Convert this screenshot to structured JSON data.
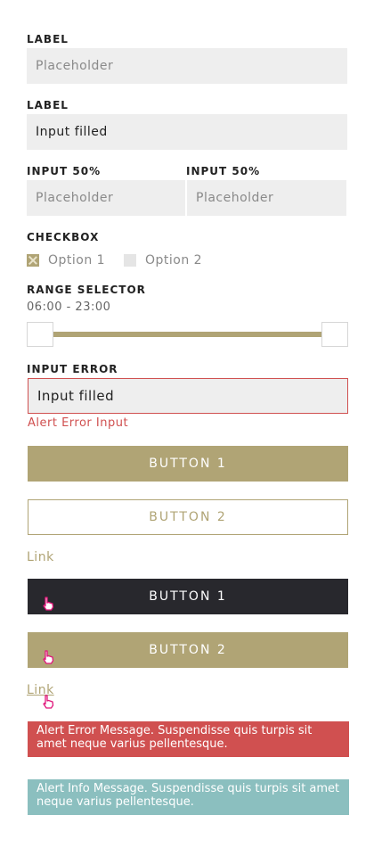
{
  "form": {
    "field1": {
      "label": "LABEL",
      "placeholder": "Placeholder"
    },
    "field2": {
      "label": "LABEL",
      "value": "Input filled"
    },
    "half_left": {
      "label": "INPUT 50%",
      "placeholder": "Placeholder"
    },
    "half_right": {
      "label": "INPUT 50%",
      "placeholder": "Placeholder"
    },
    "checkbox": {
      "label": "CHECKBOX",
      "options": [
        {
          "label": "Option 1",
          "checked": true
        },
        {
          "label": "Option 2",
          "checked": false
        }
      ]
    },
    "range": {
      "label": "RANGE SELECTOR",
      "value_text": "06:00 - 23:00"
    },
    "error_field": {
      "label": "INPUT ERROR",
      "value": "Input filled",
      "error_text": "Alert Error Input"
    }
  },
  "buttons": {
    "primary": "BUTTON 1",
    "secondary": "BUTTON 2",
    "link": "Link",
    "hover_primary": "BUTTON 1",
    "hover_secondary": "BUTTON 2",
    "hover_link": "Link"
  },
  "alerts": {
    "error": "Alert Error Message. Suspendisse quis turpis sit amet neque varius pellentesque.",
    "info": "Alert Info Message. Suspendisse quis turpis sit amet neque varius pellentesque."
  },
  "colors": {
    "accent": "#b0a475",
    "dark": "#28282d",
    "error": "#d05050",
    "info": "#8bbfbf",
    "field_bg": "#eeeeee",
    "cursor": "#e0157a"
  },
  "icons": {
    "cursor": "hand-pointer-icon"
  }
}
